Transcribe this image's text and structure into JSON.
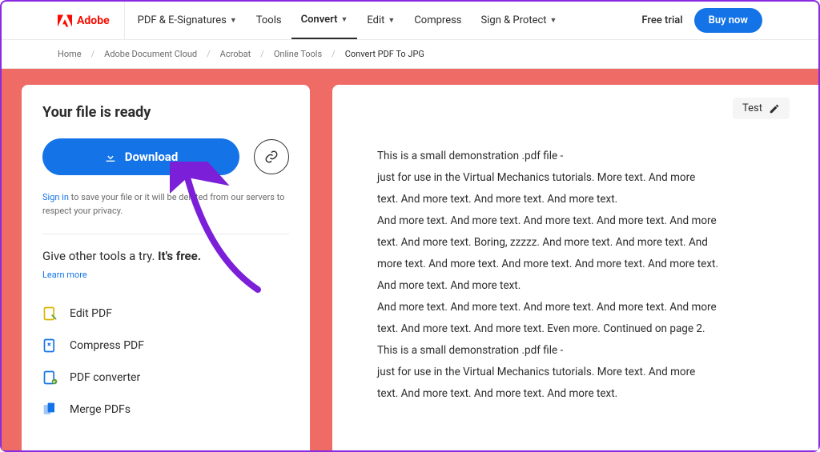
{
  "brand": {
    "name": "Adobe"
  },
  "nav": {
    "items": [
      {
        "label": "PDF & E-Signatures",
        "dropdown": true,
        "active": false
      },
      {
        "label": "Tools",
        "dropdown": false,
        "active": false
      },
      {
        "label": "Convert",
        "dropdown": true,
        "active": true
      },
      {
        "label": "Edit",
        "dropdown": true,
        "active": false
      },
      {
        "label": "Compress",
        "dropdown": false,
        "active": false
      },
      {
        "label": "Sign & Protect",
        "dropdown": true,
        "active": false
      }
    ],
    "free_trial": "Free trial",
    "buy": "Buy now"
  },
  "breadcrumb": {
    "items": [
      "Home",
      "Adobe Document Cloud",
      "Acrobat",
      "Online Tools"
    ],
    "current": "Convert PDF To JPG"
  },
  "panel": {
    "title": "Your file is ready",
    "download": "Download",
    "signin_link": "Sign in",
    "signin_text": " to save your file or it will be deleted from our servers to respect your privacy.",
    "try_text": "Give other tools a try. ",
    "try_bold": "It's free.",
    "learn": "Learn more",
    "tools": [
      {
        "label": "Edit PDF"
      },
      {
        "label": "Compress PDF"
      },
      {
        "label": "PDF converter"
      },
      {
        "label": "Merge PDFs"
      }
    ]
  },
  "preview": {
    "filename": "Test",
    "body_lines": [
      "This is a small demonstration .pdf file -",
      "just for use in the Virtual Mechanics tutorials. More text. And more",
      "text. And more text. And more text. And more text.",
      "And more text. And more text. And more text. And more text. And more",
      "text. And more text. Boring, zzzzz. And more text. And more text. And",
      "more text. And more text. And more text. And more text. And more text.",
      "And more text. And more text.",
      "And more text. And more text. And more text. And more text. And more",
      "text. And more text. And more text. Even more. Continued on page 2.",
      "",
      "This is a small demonstration .pdf file -",
      "just for use in the Virtual Mechanics tutorials. More text. And more",
      "text. And more text. And more text. And more text."
    ]
  }
}
